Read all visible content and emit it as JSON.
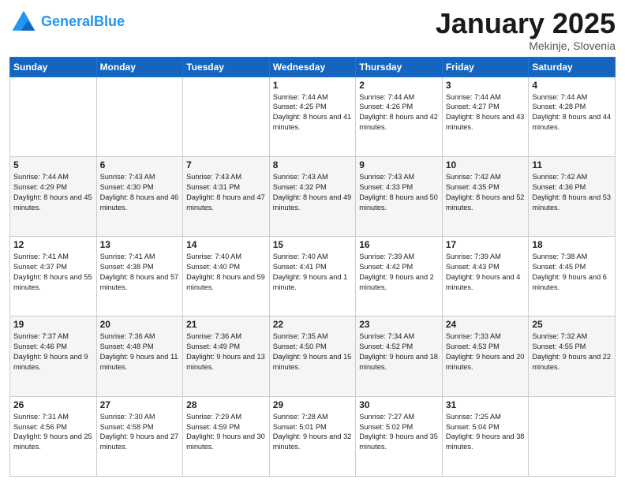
{
  "header": {
    "logo_general": "General",
    "logo_blue": "Blue",
    "month_title": "January 2025",
    "location": "Mekinje, Slovenia"
  },
  "weekdays": [
    "Sunday",
    "Monday",
    "Tuesday",
    "Wednesday",
    "Thursday",
    "Friday",
    "Saturday"
  ],
  "weeks": [
    [
      {
        "day": "",
        "info": ""
      },
      {
        "day": "",
        "info": ""
      },
      {
        "day": "",
        "info": ""
      },
      {
        "day": "1",
        "info": "Sunrise: 7:44 AM\nSunset: 4:25 PM\nDaylight: 8 hours and 41 minutes."
      },
      {
        "day": "2",
        "info": "Sunrise: 7:44 AM\nSunset: 4:26 PM\nDaylight: 8 hours and 42 minutes."
      },
      {
        "day": "3",
        "info": "Sunrise: 7:44 AM\nSunset: 4:27 PM\nDaylight: 8 hours and 43 minutes."
      },
      {
        "day": "4",
        "info": "Sunrise: 7:44 AM\nSunset: 4:28 PM\nDaylight: 8 hours and 44 minutes."
      }
    ],
    [
      {
        "day": "5",
        "info": "Sunrise: 7:44 AM\nSunset: 4:29 PM\nDaylight: 8 hours and 45 minutes."
      },
      {
        "day": "6",
        "info": "Sunrise: 7:43 AM\nSunset: 4:30 PM\nDaylight: 8 hours and 46 minutes."
      },
      {
        "day": "7",
        "info": "Sunrise: 7:43 AM\nSunset: 4:31 PM\nDaylight: 8 hours and 47 minutes."
      },
      {
        "day": "8",
        "info": "Sunrise: 7:43 AM\nSunset: 4:32 PM\nDaylight: 8 hours and 49 minutes."
      },
      {
        "day": "9",
        "info": "Sunrise: 7:43 AM\nSunset: 4:33 PM\nDaylight: 8 hours and 50 minutes."
      },
      {
        "day": "10",
        "info": "Sunrise: 7:42 AM\nSunset: 4:35 PM\nDaylight: 8 hours and 52 minutes."
      },
      {
        "day": "11",
        "info": "Sunrise: 7:42 AM\nSunset: 4:36 PM\nDaylight: 8 hours and 53 minutes."
      }
    ],
    [
      {
        "day": "12",
        "info": "Sunrise: 7:41 AM\nSunset: 4:37 PM\nDaylight: 8 hours and 55 minutes."
      },
      {
        "day": "13",
        "info": "Sunrise: 7:41 AM\nSunset: 4:38 PM\nDaylight: 8 hours and 57 minutes."
      },
      {
        "day": "14",
        "info": "Sunrise: 7:40 AM\nSunset: 4:40 PM\nDaylight: 8 hours and 59 minutes."
      },
      {
        "day": "15",
        "info": "Sunrise: 7:40 AM\nSunset: 4:41 PM\nDaylight: 9 hours and 1 minute."
      },
      {
        "day": "16",
        "info": "Sunrise: 7:39 AM\nSunset: 4:42 PM\nDaylight: 9 hours and 2 minutes."
      },
      {
        "day": "17",
        "info": "Sunrise: 7:39 AM\nSunset: 4:43 PM\nDaylight: 9 hours and 4 minutes."
      },
      {
        "day": "18",
        "info": "Sunrise: 7:38 AM\nSunset: 4:45 PM\nDaylight: 9 hours and 6 minutes."
      }
    ],
    [
      {
        "day": "19",
        "info": "Sunrise: 7:37 AM\nSunset: 4:46 PM\nDaylight: 9 hours and 9 minutes."
      },
      {
        "day": "20",
        "info": "Sunrise: 7:36 AM\nSunset: 4:48 PM\nDaylight: 9 hours and 11 minutes."
      },
      {
        "day": "21",
        "info": "Sunrise: 7:36 AM\nSunset: 4:49 PM\nDaylight: 9 hours and 13 minutes."
      },
      {
        "day": "22",
        "info": "Sunrise: 7:35 AM\nSunset: 4:50 PM\nDaylight: 9 hours and 15 minutes."
      },
      {
        "day": "23",
        "info": "Sunrise: 7:34 AM\nSunset: 4:52 PM\nDaylight: 9 hours and 18 minutes."
      },
      {
        "day": "24",
        "info": "Sunrise: 7:33 AM\nSunset: 4:53 PM\nDaylight: 9 hours and 20 minutes."
      },
      {
        "day": "25",
        "info": "Sunrise: 7:32 AM\nSunset: 4:55 PM\nDaylight: 9 hours and 22 minutes."
      }
    ],
    [
      {
        "day": "26",
        "info": "Sunrise: 7:31 AM\nSunset: 4:56 PM\nDaylight: 9 hours and 25 minutes."
      },
      {
        "day": "27",
        "info": "Sunrise: 7:30 AM\nSunset: 4:58 PM\nDaylight: 9 hours and 27 minutes."
      },
      {
        "day": "28",
        "info": "Sunrise: 7:29 AM\nSunset: 4:59 PM\nDaylight: 9 hours and 30 minutes."
      },
      {
        "day": "29",
        "info": "Sunrise: 7:28 AM\nSunset: 5:01 PM\nDaylight: 9 hours and 32 minutes."
      },
      {
        "day": "30",
        "info": "Sunrise: 7:27 AM\nSunset: 5:02 PM\nDaylight: 9 hours and 35 minutes."
      },
      {
        "day": "31",
        "info": "Sunrise: 7:25 AM\nSunset: 5:04 PM\nDaylight: 9 hours and 38 minutes."
      },
      {
        "day": "",
        "info": ""
      }
    ]
  ]
}
